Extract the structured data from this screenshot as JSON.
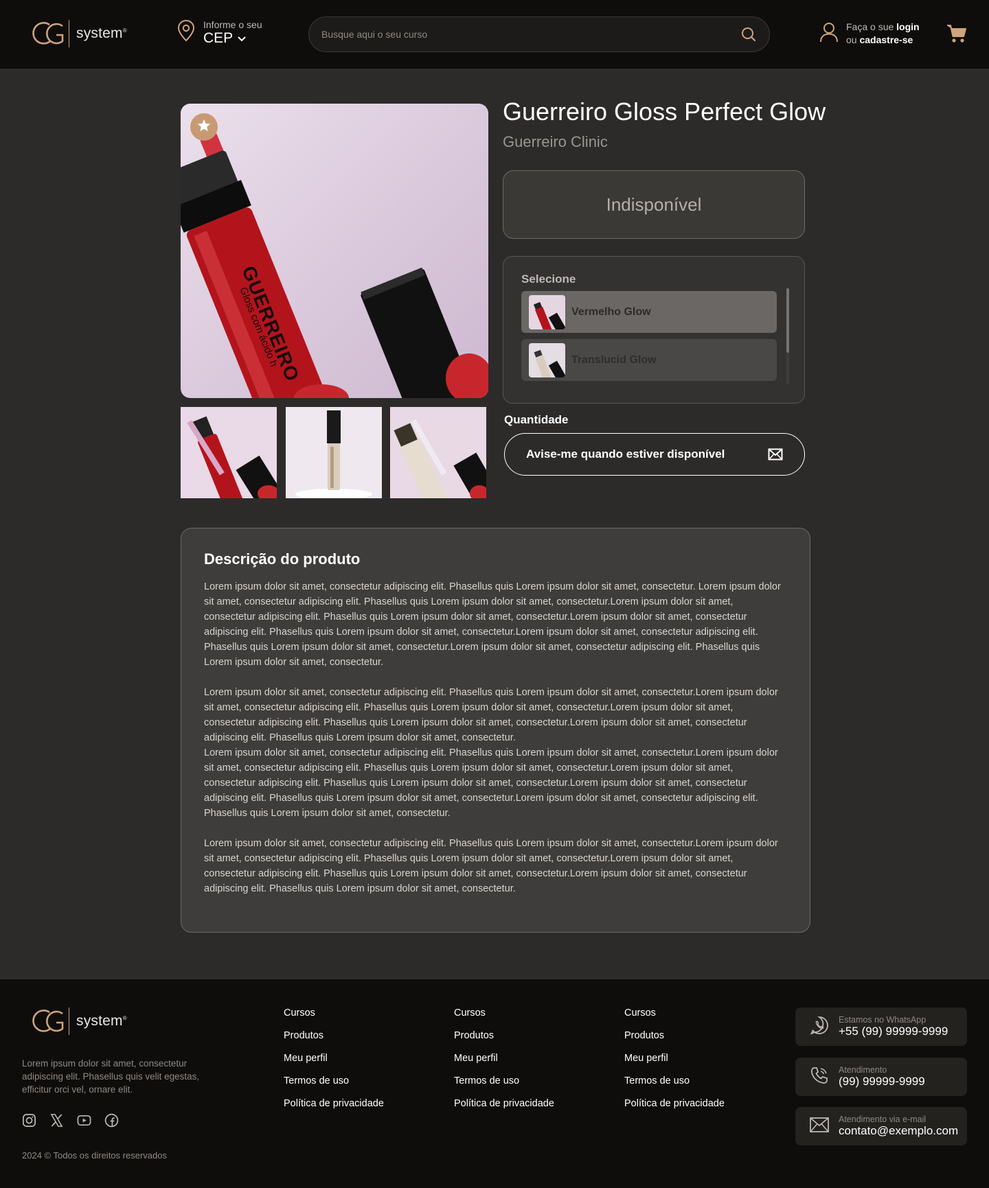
{
  "header": {
    "logo_word": "system",
    "logo_reg": "®",
    "cep_small": "Informe o seu",
    "cep_big": "CEP",
    "search_placeholder": "Busque aqui o seu curso",
    "login_pre": "Faça o sue",
    "login_bold": "login",
    "login_or": "ou",
    "signup_bold": "cadastre-se"
  },
  "product": {
    "title": "Guerreiro Gloss Perfect Glow",
    "brand": "Guerreiro Clinic",
    "status": "Indisponível",
    "select_label": "Selecione",
    "variants": [
      {
        "label": "Vermelho Glow",
        "selected": true
      },
      {
        "label": "Translucid Glow",
        "selected": false
      }
    ],
    "quantity_label": "Quantidade",
    "notify_label": "Avise-me quando estiver disponível",
    "image_text": "GUERREIRO",
    "image_subtext": "Gloss com ácido h"
  },
  "description": {
    "title": "Descrição do produto",
    "paragraphs": [
      "Lorem ipsum dolor sit amet, consectetur adipiscing elit. Phasellus quis Lorem ipsum dolor sit amet, consectetur. Lorem ipsum dolor sit amet, consectetur adipiscing elit. Phasellus quis Lorem ipsum dolor sit amet, consectetur.Lorem ipsum dolor sit amet, consectetur adipiscing elit. Phasellus quis Lorem ipsum dolor sit amet, consectetur.Lorem ipsum dolor sit amet, consectetur adipiscing elit. Phasellus quis Lorem ipsum dolor sit amet, consectetur.Lorem ipsum dolor sit amet, consectetur adipiscing elit. Phasellus quis Lorem ipsum dolor sit amet, consectetur.Lorem ipsum dolor sit amet, consectetur adipiscing elit. Phasellus quis Lorem ipsum dolor sit amet, consectetur.",
      "Lorem ipsum dolor sit amet, consectetur adipiscing elit. Phasellus quis Lorem ipsum dolor sit amet, consectetur.Lorem ipsum dolor sit amet, consectetur adipiscing elit. Phasellus quis Lorem ipsum dolor sit amet, consectetur.Lorem ipsum dolor sit amet, consectetur adipiscing elit. Phasellus quis Lorem ipsum dolor sit amet, consectetur.Lorem ipsum dolor sit amet, consectetur adipiscing elit. Phasellus quis Lorem ipsum dolor sit amet, consectetur.",
      "Lorem ipsum dolor sit amet, consectetur adipiscing elit. Phasellus quis Lorem ipsum dolor sit amet, consectetur.Lorem ipsum dolor sit amet, consectetur adipiscing elit. Phasellus quis Lorem ipsum dolor sit amet, consectetur.Lorem ipsum dolor sit amet, consectetur adipiscing elit. Phasellus quis Lorem ipsum dolor sit amet, consectetur.Lorem ipsum dolor sit amet, consectetur adipiscing elit. Phasellus quis Lorem ipsum dolor sit amet, consectetur.Lorem ipsum dolor sit amet, consectetur adipiscing elit. Phasellus quis Lorem ipsum dolor sit amet, consectetur.",
      "Lorem ipsum dolor sit amet, consectetur adipiscing elit. Phasellus quis Lorem ipsum dolor sit amet, consectetur.Lorem ipsum dolor sit amet, consectetur adipiscing elit. Phasellus quis Lorem ipsum dolor sit amet, consectetur.Lorem ipsum dolor sit amet, consectetur adipiscing elit. Phasellus quis Lorem ipsum dolor sit amet, consectetur.Lorem ipsum dolor sit amet, consectetur adipiscing elit. Phasellus quis Lorem ipsum dolor sit amet, consectetur."
    ]
  },
  "footer": {
    "about": "Lorem ipsum dolor sit amet, consectetur adipiscing elit. Phasellus quis velit egestas, efficitur orci vel, ornare elit.",
    "copyright": "2024 © Todos os direitos reservados",
    "social_icons": [
      "instagram-icon",
      "x-icon",
      "youtube-icon",
      "facebook-icon"
    ],
    "link_columns": [
      [
        "Cursos",
        "Produtos",
        "Meu perfil",
        "Termos de uso",
        "Política de privacidade"
      ],
      [
        "Cursos",
        "Produtos",
        "Meu perfil",
        "Termos de uso",
        "Política de privacidade"
      ],
      [
        "Cursos",
        "Produtos",
        "Meu perfil",
        "Termos de uso",
        "Política de privacidade"
      ]
    ],
    "contacts": [
      {
        "icon": "whatsapp-icon",
        "small": "Estamos no WhatsApp",
        "big": "+55 (99) 99999-9999"
      },
      {
        "icon": "phone-icon",
        "small": "Atendimento",
        "big": "(99) 99999-9999"
      },
      {
        "icon": "mail-icon",
        "small": "Atendimento via e-mail",
        "big": "contato@exemplo.com"
      }
    ]
  },
  "colors": {
    "accent": "#c89a74",
    "header_bg": "#0f0d0c",
    "page_bg": "#2c2b2a",
    "panel_bg": "#3f3d3b"
  }
}
